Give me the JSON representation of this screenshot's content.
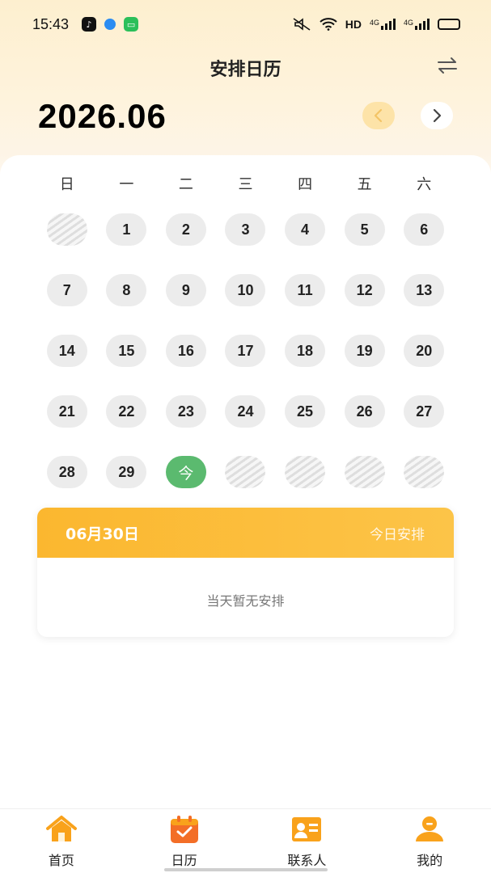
{
  "status_bar": {
    "time": "15:43",
    "hd_label": "HD",
    "net1": "4G",
    "net2": "4G",
    "battery_level": 0.95
  },
  "header": {
    "title": "安排日历",
    "swap_icon": "swap-arrows-icon"
  },
  "month": {
    "label": "2026.06",
    "prev_icon": "chevron-left-icon",
    "next_icon": "chevron-right-icon"
  },
  "weekdays": [
    "日",
    "一",
    "二",
    "三",
    "四",
    "五",
    "六"
  ],
  "days": [
    "",
    "1",
    "2",
    "3",
    "4",
    "5",
    "6",
    "7",
    "8",
    "9",
    "10",
    "11",
    "12",
    "13",
    "14",
    "15",
    "16",
    "17",
    "18",
    "19",
    "20",
    "21",
    "22",
    "23",
    "24",
    "25",
    "26",
    "27",
    "28",
    "29",
    "今",
    "",
    "",
    "",
    ""
  ],
  "today_index": 30,
  "schedule": {
    "date": "06月30日",
    "tag": "今日安排",
    "empty_text": "当天暂无安排"
  },
  "bottom_nav": [
    {
      "label": "首页",
      "icon": "home-icon"
    },
    {
      "label": "日历",
      "icon": "calendar-icon"
    },
    {
      "label": "联系人",
      "icon": "contact-card-icon"
    },
    {
      "label": "我的",
      "icon": "user-icon"
    }
  ],
  "colors": {
    "accent": "#fbb72f",
    "today": "#5bba6f",
    "nav_icon": "#f9a21b"
  }
}
